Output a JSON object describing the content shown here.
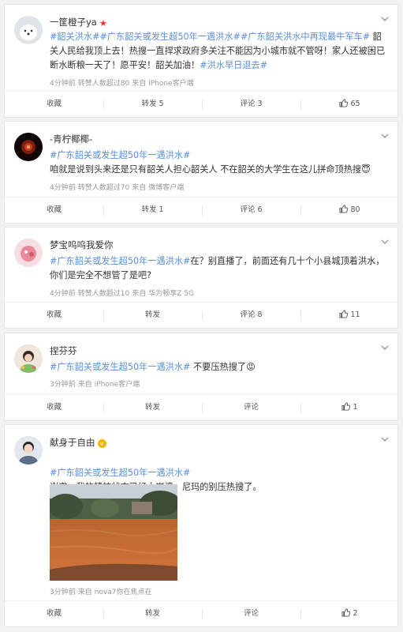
{
  "posts": [
    {
      "username": "一筐橙子ya",
      "badge": "★",
      "text_parts": [
        {
          "t": "#韶关洪水##广东韶关或发生超50年一遇洪水##广东韶关洪水中再现最牛军车#",
          "tag": true
        },
        {
          "t": " 韶关人民给我顶上去！热搜一直捍求政府多关注不能因为小城市就不管呀！家人还被困已断水断粮一天了！愿平安！韶关加油！",
          "tag": false
        },
        {
          "t": "#洪水早日退去#",
          "tag": true
        }
      ],
      "meta": [
        "4分钟前",
        "转赞人数超过80",
        "来自",
        "iPhone客户端"
      ],
      "actions": {
        "favorite": "收藏",
        "repost": "转发 5",
        "comment": "评论 3",
        "like": "65"
      }
    },
    {
      "username": "-青柠椰椰-",
      "text_parts": [
        {
          "t": "#广东韶关或发生超50年一遇洪水#",
          "tag": true
        },
        {
          "t": "咱就是说到头来还是只有韶关人担心韶关人 不在韶关的大学生在这儿拼命顶热搜😇",
          "tag": false
        }
      ],
      "meta": [
        "4分钟前",
        "转赞人数超过70",
        "来自",
        "微博客户端"
      ],
      "actions": {
        "favorite": "收藏",
        "repost": "转发 1",
        "comment": "评论 6",
        "like": "80"
      }
    },
    {
      "username": "梦宝呜呜我爱你",
      "text_parts": [
        {
          "t": "#广东韶关或发生超50年一遇洪水#",
          "tag": true
        },
        {
          "t": "在？别直播了，前面还有几十个小县城顶着洪水，你们是完全不想管了是吧?",
          "tag": false
        }
      ],
      "meta": [
        "4分钟前",
        "转赞人数超过10",
        "来自",
        "华为畅享Z 5G"
      ],
      "actions": {
        "favorite": "收藏",
        "repost": "转发",
        "comment": "评论 8",
        "like": "11"
      }
    },
    {
      "username": "捏芬芬",
      "text_parts": [
        {
          "t": "#广东韶关或发生超50年一遇洪水#",
          "tag": true
        },
        {
          "t": " 不要压热搜了😡",
          "tag": false
        }
      ],
      "meta": [
        "3分钟前",
        "来自",
        "iPhone客户端"
      ],
      "actions": {
        "favorite": "收藏",
        "repost": "转发",
        "comment": "评论",
        "like": "1"
      }
    },
    {
      "username": "献身于自由",
      "badge": "v",
      "text_parts": [
        {
          "t": "#广东韶关或发生超50年一遇洪水#",
          "tag": true
        },
        {
          "t": "\n谢邀，我的精神状态已经大崩溃，尼玛的别压热搜了。",
          "tag": false
        }
      ],
      "meta": [
        "3分钟前",
        "来自",
        "nova7你在焦点在"
      ],
      "actions": {
        "favorite": "收藏",
        "repost": "转发",
        "comment": "评论",
        "like": "2"
      }
    }
  ],
  "colors": {
    "tag": "#5b90d6",
    "badge_red": "#e8341c",
    "badge_gold": "#f5b401"
  },
  "icons": {
    "menu": "chevron-down-icon",
    "like": "thumbs-up-icon"
  }
}
